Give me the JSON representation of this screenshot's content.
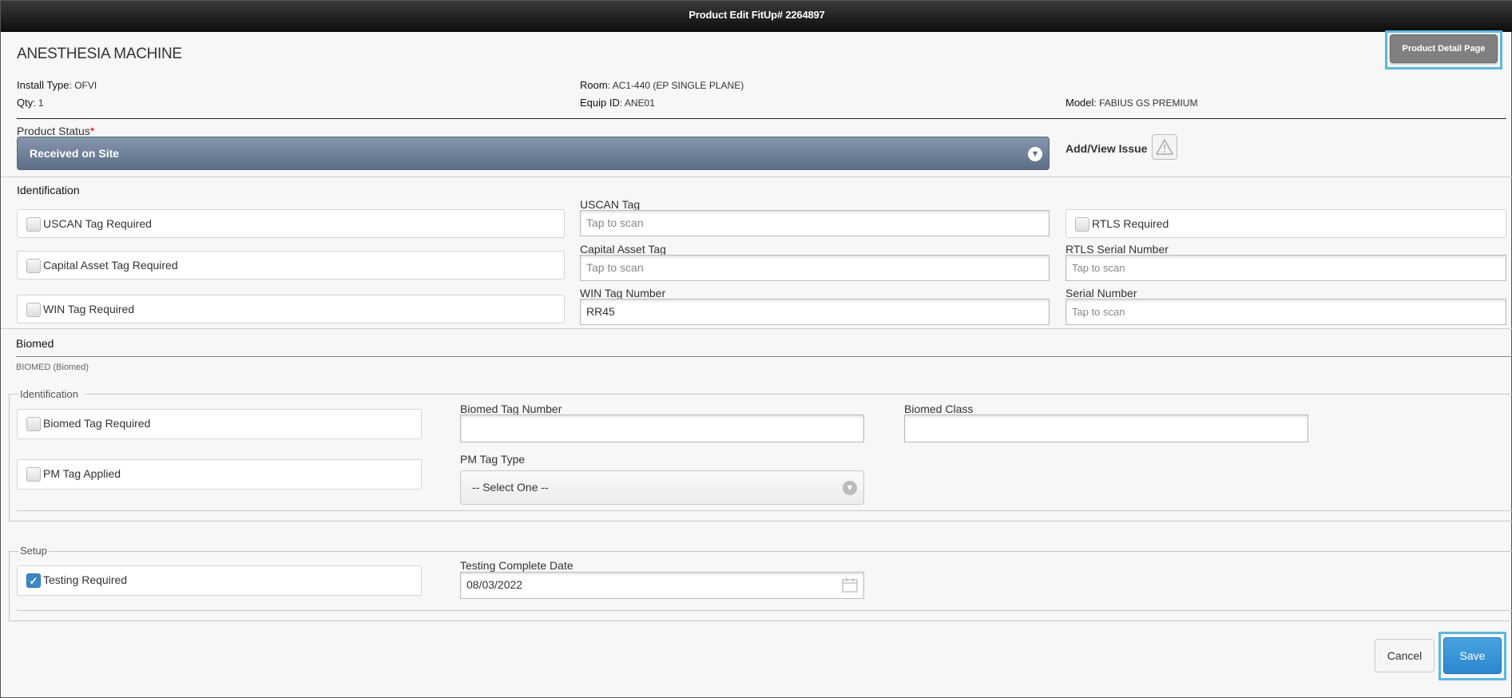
{
  "window": {
    "title": "Product Edit  FitUp# 2264897"
  },
  "header": {
    "product_name": "ANESTHESIA MACHINE",
    "detail_button": "Product Detail Page",
    "install_type_label": "Install Type",
    "install_type_value": ": OFVI",
    "qty_label": "Qty",
    "qty_value": ": 1",
    "room_label": "Room",
    "room_value": ": AC1-440 (EP SINGLE PLANE)",
    "equip_label": "Equip ID",
    "equip_value": ": ANE01",
    "model_label": "Model",
    "model_value": ": FABIUS GS PREMIUM"
  },
  "status": {
    "label": "Product Status",
    "required_mark": "*",
    "value": "Received on Site",
    "issue_label": "Add/View Issue",
    "chevron_icon": "chevron-down-icon",
    "issue_icon": "warning-triangle-icon"
  },
  "identification": {
    "heading": "Identification",
    "uscan_required": "USCAN Tag Required",
    "capital_required": "Capital Asset Tag Required",
    "win_required": "WIN Tag Required",
    "uscan_tag_label": "USCAN Tag",
    "uscan_tag_placeholder": "Tap to scan",
    "capital_tag_label": "Capital Asset Tag",
    "capital_tag_placeholder": "Tap to scan",
    "win_tag_label": "WIN Tag Number",
    "win_tag_value": "RR45",
    "rtls_required": "RTLS Required",
    "rtls_serial_label": "RTLS Serial Number",
    "rtls_serial_placeholder": "Tap to scan",
    "serial_label": "Serial Number",
    "serial_placeholder": "Tap to scan"
  },
  "biomed": {
    "heading": "Biomed",
    "subheading": "BIOMED (Biomed)",
    "group_heading": "Identification",
    "tag_required": "Biomed Tag Required",
    "pm_applied": "PM Tag Applied",
    "tag_number_label": "Biomed Tag Number",
    "tag_number_value": "",
    "pm_type_label": "PM Tag Type",
    "pm_type_value": "-- Select One --",
    "class_label": "Biomed Class",
    "class_value": ""
  },
  "setup": {
    "heading": "Setup",
    "testing_required": "Testing Required",
    "testing_checked": true,
    "testing_date_label": "Testing Complete Date",
    "testing_date_value": "08/03/2022",
    "calendar_icon": "calendar-icon"
  },
  "footer": {
    "cancel": "Cancel",
    "save": "Save"
  },
  "colors": {
    "highlight": "#5bb8dd",
    "save": "#2b88cf",
    "status_select": "#6d7d95"
  }
}
